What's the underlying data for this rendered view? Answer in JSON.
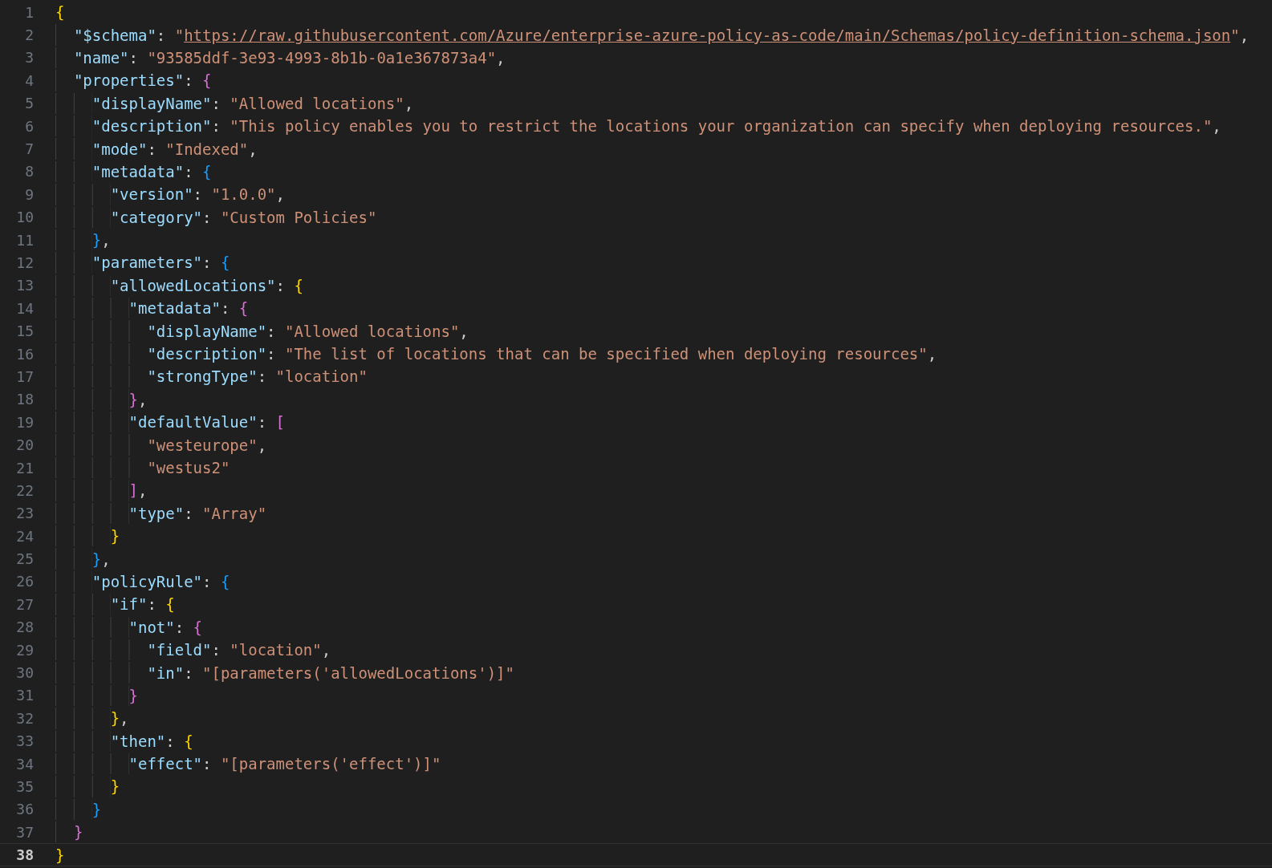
{
  "editor": {
    "lines": [
      {
        "number": "1",
        "current": false,
        "tokens": [
          {
            "kind": "bracket",
            "text": "{",
            "color": "#ffd700"
          }
        ]
      },
      {
        "number": "2",
        "current": false,
        "tokens": [
          {
            "kind": "key",
            "text": "\"$schema\""
          },
          {
            "kind": "punct",
            "text": ": "
          },
          {
            "kind": "string",
            "text": "\""
          },
          {
            "kind": "link",
            "text": "https://raw.githubusercontent.com/Azure/enterprise-azure-policy-as-code/main/Schemas/policy-definition-schema.json"
          },
          {
            "kind": "string",
            "text": "\""
          },
          {
            "kind": "punct",
            "text": ","
          }
        ]
      },
      {
        "number": "3",
        "current": false,
        "tokens": [
          {
            "kind": "key",
            "text": "\"name\""
          },
          {
            "kind": "punct",
            "text": ": "
          },
          {
            "kind": "string",
            "text": "\"93585ddf-3e93-4993-8b1b-0a1e367873a4\""
          },
          {
            "kind": "punct",
            "text": ","
          }
        ]
      },
      {
        "number": "4",
        "current": false,
        "tokens": [
          {
            "kind": "key",
            "text": "\"properties\""
          },
          {
            "kind": "punct",
            "text": ": "
          },
          {
            "kind": "bracket",
            "text": "{",
            "color": "#da70d6"
          }
        ]
      },
      {
        "number": "5",
        "current": false,
        "tokens": [
          {
            "kind": "key",
            "text": "\"displayName\""
          },
          {
            "kind": "punct",
            "text": ": "
          },
          {
            "kind": "string",
            "text": "\"Allowed locations\""
          },
          {
            "kind": "punct",
            "text": ","
          }
        ]
      },
      {
        "number": "6",
        "current": false,
        "tokens": [
          {
            "kind": "key",
            "text": "\"description\""
          },
          {
            "kind": "punct",
            "text": ": "
          },
          {
            "kind": "string",
            "text": "\"This policy enables you to restrict the locations your organization can specify when deploying resources.\""
          },
          {
            "kind": "punct",
            "text": ","
          }
        ]
      },
      {
        "number": "7",
        "current": false,
        "tokens": [
          {
            "kind": "key",
            "text": "\"mode\""
          },
          {
            "kind": "punct",
            "text": ": "
          },
          {
            "kind": "string",
            "text": "\"Indexed\""
          },
          {
            "kind": "punct",
            "text": ","
          }
        ]
      },
      {
        "number": "8",
        "current": false,
        "tokens": [
          {
            "kind": "key",
            "text": "\"metadata\""
          },
          {
            "kind": "punct",
            "text": ": "
          },
          {
            "kind": "bracket",
            "text": "{",
            "color": "#179fff"
          }
        ]
      },
      {
        "number": "9",
        "current": false,
        "tokens": [
          {
            "kind": "key",
            "text": "\"version\""
          },
          {
            "kind": "punct",
            "text": ": "
          },
          {
            "kind": "string",
            "text": "\"1.0.0\""
          },
          {
            "kind": "punct",
            "text": ","
          }
        ]
      },
      {
        "number": "10",
        "current": false,
        "tokens": [
          {
            "kind": "key",
            "text": "\"category\""
          },
          {
            "kind": "punct",
            "text": ": "
          },
          {
            "kind": "string",
            "text": "\"Custom Policies\""
          }
        ]
      },
      {
        "number": "11",
        "current": false,
        "tokens": [
          {
            "kind": "bracket",
            "text": "}",
            "color": "#179fff"
          },
          {
            "kind": "punct",
            "text": ","
          }
        ]
      },
      {
        "number": "12",
        "current": false,
        "tokens": [
          {
            "kind": "key",
            "text": "\"parameters\""
          },
          {
            "kind": "punct",
            "text": ": "
          },
          {
            "kind": "bracket",
            "text": "{",
            "color": "#179fff"
          }
        ]
      },
      {
        "number": "13",
        "current": false,
        "tokens": [
          {
            "kind": "key",
            "text": "\"allowedLocations\""
          },
          {
            "kind": "punct",
            "text": ": "
          },
          {
            "kind": "bracket",
            "text": "{",
            "color": "#ffd700"
          }
        ]
      },
      {
        "number": "14",
        "current": false,
        "tokens": [
          {
            "kind": "key",
            "text": "\"metadata\""
          },
          {
            "kind": "punct",
            "text": ": "
          },
          {
            "kind": "bracket",
            "text": "{",
            "color": "#da70d6"
          }
        ]
      },
      {
        "number": "15",
        "current": false,
        "tokens": [
          {
            "kind": "key",
            "text": "\"displayName\""
          },
          {
            "kind": "punct",
            "text": ": "
          },
          {
            "kind": "string",
            "text": "\"Allowed locations\""
          },
          {
            "kind": "punct",
            "text": ","
          }
        ]
      },
      {
        "number": "16",
        "current": false,
        "tokens": [
          {
            "kind": "key",
            "text": "\"description\""
          },
          {
            "kind": "punct",
            "text": ": "
          },
          {
            "kind": "string",
            "text": "\"The list of locations that can be specified when deploying resources\""
          },
          {
            "kind": "punct",
            "text": ","
          }
        ]
      },
      {
        "number": "17",
        "current": false,
        "tokens": [
          {
            "kind": "key",
            "text": "\"strongType\""
          },
          {
            "kind": "punct",
            "text": ": "
          },
          {
            "kind": "string",
            "text": "\"location\""
          }
        ]
      },
      {
        "number": "18",
        "current": false,
        "tokens": [
          {
            "kind": "bracket",
            "text": "}",
            "color": "#da70d6"
          },
          {
            "kind": "punct",
            "text": ","
          }
        ]
      },
      {
        "number": "19",
        "current": false,
        "tokens": [
          {
            "kind": "key",
            "text": "\"defaultValue\""
          },
          {
            "kind": "punct",
            "text": ": "
          },
          {
            "kind": "bracket",
            "text": "[",
            "color": "#da70d6"
          }
        ]
      },
      {
        "number": "20",
        "current": false,
        "tokens": [
          {
            "kind": "string",
            "text": "\"westeurope\""
          },
          {
            "kind": "punct",
            "text": ","
          }
        ]
      },
      {
        "number": "21",
        "current": false,
        "tokens": [
          {
            "kind": "string",
            "text": "\"westus2\""
          }
        ]
      },
      {
        "number": "22",
        "current": false,
        "tokens": [
          {
            "kind": "bracket",
            "text": "]",
            "color": "#da70d6"
          },
          {
            "kind": "punct",
            "text": ","
          }
        ]
      },
      {
        "number": "23",
        "current": false,
        "tokens": [
          {
            "kind": "key",
            "text": "\"type\""
          },
          {
            "kind": "punct",
            "text": ": "
          },
          {
            "kind": "string",
            "text": "\"Array\""
          }
        ]
      },
      {
        "number": "24",
        "current": false,
        "tokens": [
          {
            "kind": "bracket",
            "text": "}",
            "color": "#ffd700"
          }
        ]
      },
      {
        "number": "25",
        "current": false,
        "tokens": [
          {
            "kind": "bracket",
            "text": "}",
            "color": "#179fff"
          },
          {
            "kind": "punct",
            "text": ","
          }
        ]
      },
      {
        "number": "26",
        "current": false,
        "tokens": [
          {
            "kind": "key",
            "text": "\"policyRule\""
          },
          {
            "kind": "punct",
            "text": ": "
          },
          {
            "kind": "bracket",
            "text": "{",
            "color": "#179fff"
          }
        ]
      },
      {
        "number": "27",
        "current": false,
        "tokens": [
          {
            "kind": "key",
            "text": "\"if\""
          },
          {
            "kind": "punct",
            "text": ": "
          },
          {
            "kind": "bracket",
            "text": "{",
            "color": "#ffd700"
          }
        ]
      },
      {
        "number": "28",
        "current": false,
        "tokens": [
          {
            "kind": "key",
            "text": "\"not\""
          },
          {
            "kind": "punct",
            "text": ": "
          },
          {
            "kind": "bracket",
            "text": "{",
            "color": "#da70d6"
          }
        ]
      },
      {
        "number": "29",
        "current": false,
        "tokens": [
          {
            "kind": "key",
            "text": "\"field\""
          },
          {
            "kind": "punct",
            "text": ": "
          },
          {
            "kind": "string",
            "text": "\"location\""
          },
          {
            "kind": "punct",
            "text": ","
          }
        ]
      },
      {
        "number": "30",
        "current": false,
        "tokens": [
          {
            "kind": "key",
            "text": "\"in\""
          },
          {
            "kind": "punct",
            "text": ": "
          },
          {
            "kind": "string",
            "text": "\"[parameters('allowedLocations')]\""
          }
        ]
      },
      {
        "number": "31",
        "current": false,
        "tokens": [
          {
            "kind": "bracket",
            "text": "}",
            "color": "#da70d6"
          }
        ]
      },
      {
        "number": "32",
        "current": false,
        "tokens": [
          {
            "kind": "bracket",
            "text": "}",
            "color": "#ffd700"
          },
          {
            "kind": "punct",
            "text": ","
          }
        ]
      },
      {
        "number": "33",
        "current": false,
        "tokens": [
          {
            "kind": "key",
            "text": "\"then\""
          },
          {
            "kind": "punct",
            "text": ": "
          },
          {
            "kind": "bracket",
            "text": "{",
            "color": "#ffd700"
          }
        ]
      },
      {
        "number": "34",
        "current": false,
        "tokens": [
          {
            "kind": "key",
            "text": "\"effect\""
          },
          {
            "kind": "punct",
            "text": ": "
          },
          {
            "kind": "string",
            "text": "\"[parameters('effect')]\""
          }
        ]
      },
      {
        "number": "35",
        "current": false,
        "tokens": [
          {
            "kind": "bracket",
            "text": "}",
            "color": "#ffd700"
          }
        ]
      },
      {
        "number": "36",
        "current": false,
        "tokens": [
          {
            "kind": "bracket",
            "text": "}",
            "color": "#179fff"
          }
        ]
      },
      {
        "number": "37",
        "current": false,
        "tokens": [
          {
            "kind": "bracket",
            "text": "}",
            "color": "#da70d6"
          }
        ]
      },
      {
        "number": "38",
        "current": true,
        "tokens": [
          {
            "kind": "bracket",
            "text": "}",
            "color": "#ffd700"
          }
        ]
      }
    ]
  }
}
